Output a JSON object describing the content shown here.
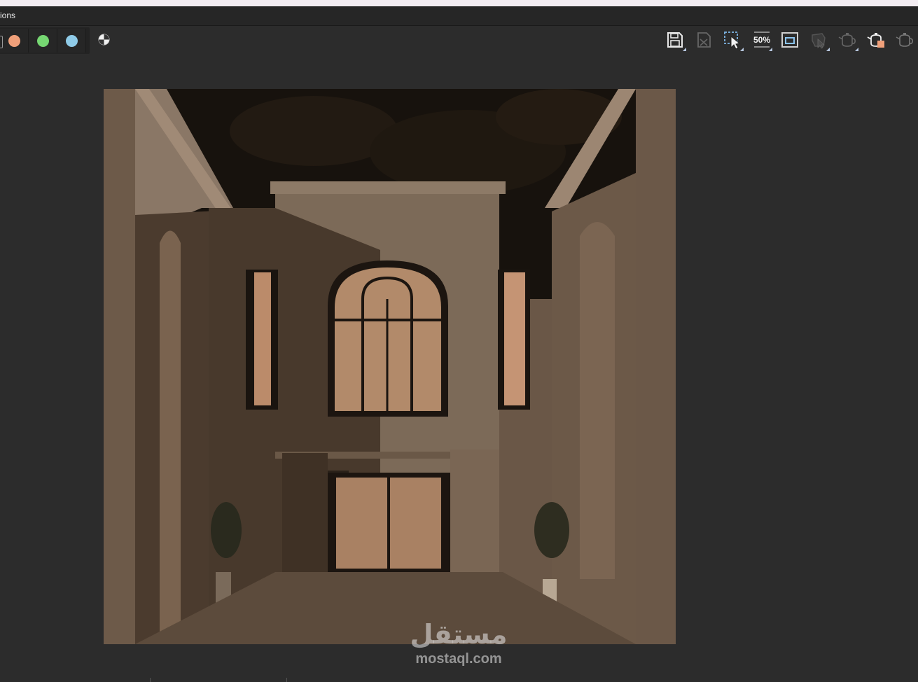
{
  "menubar": {
    "visible_item": "ions"
  },
  "channels": [
    {
      "name": "red-channel",
      "color": "#f0a07a"
    },
    {
      "name": "green-channel",
      "color": "#76d772"
    },
    {
      "name": "blue-channel",
      "color": "#8fcbe8"
    }
  ],
  "toolbar_icons": [
    "save-image-icon",
    "clear-image-icon",
    "region-select-icon",
    "zoom-50-icon",
    "frame-icon",
    "render-type-icon",
    "teapot-render-icon",
    "teapot-active-render-icon",
    "teapot-iterative-icon"
  ],
  "zoom": {
    "label": "50%"
  },
  "watermark": {
    "arabic": "مستقل",
    "url": "mostaql.com"
  },
  "colors": {
    "background": "#2c2c2c",
    "render_tone": "#6a5747",
    "accent": "#f0a07a"
  }
}
